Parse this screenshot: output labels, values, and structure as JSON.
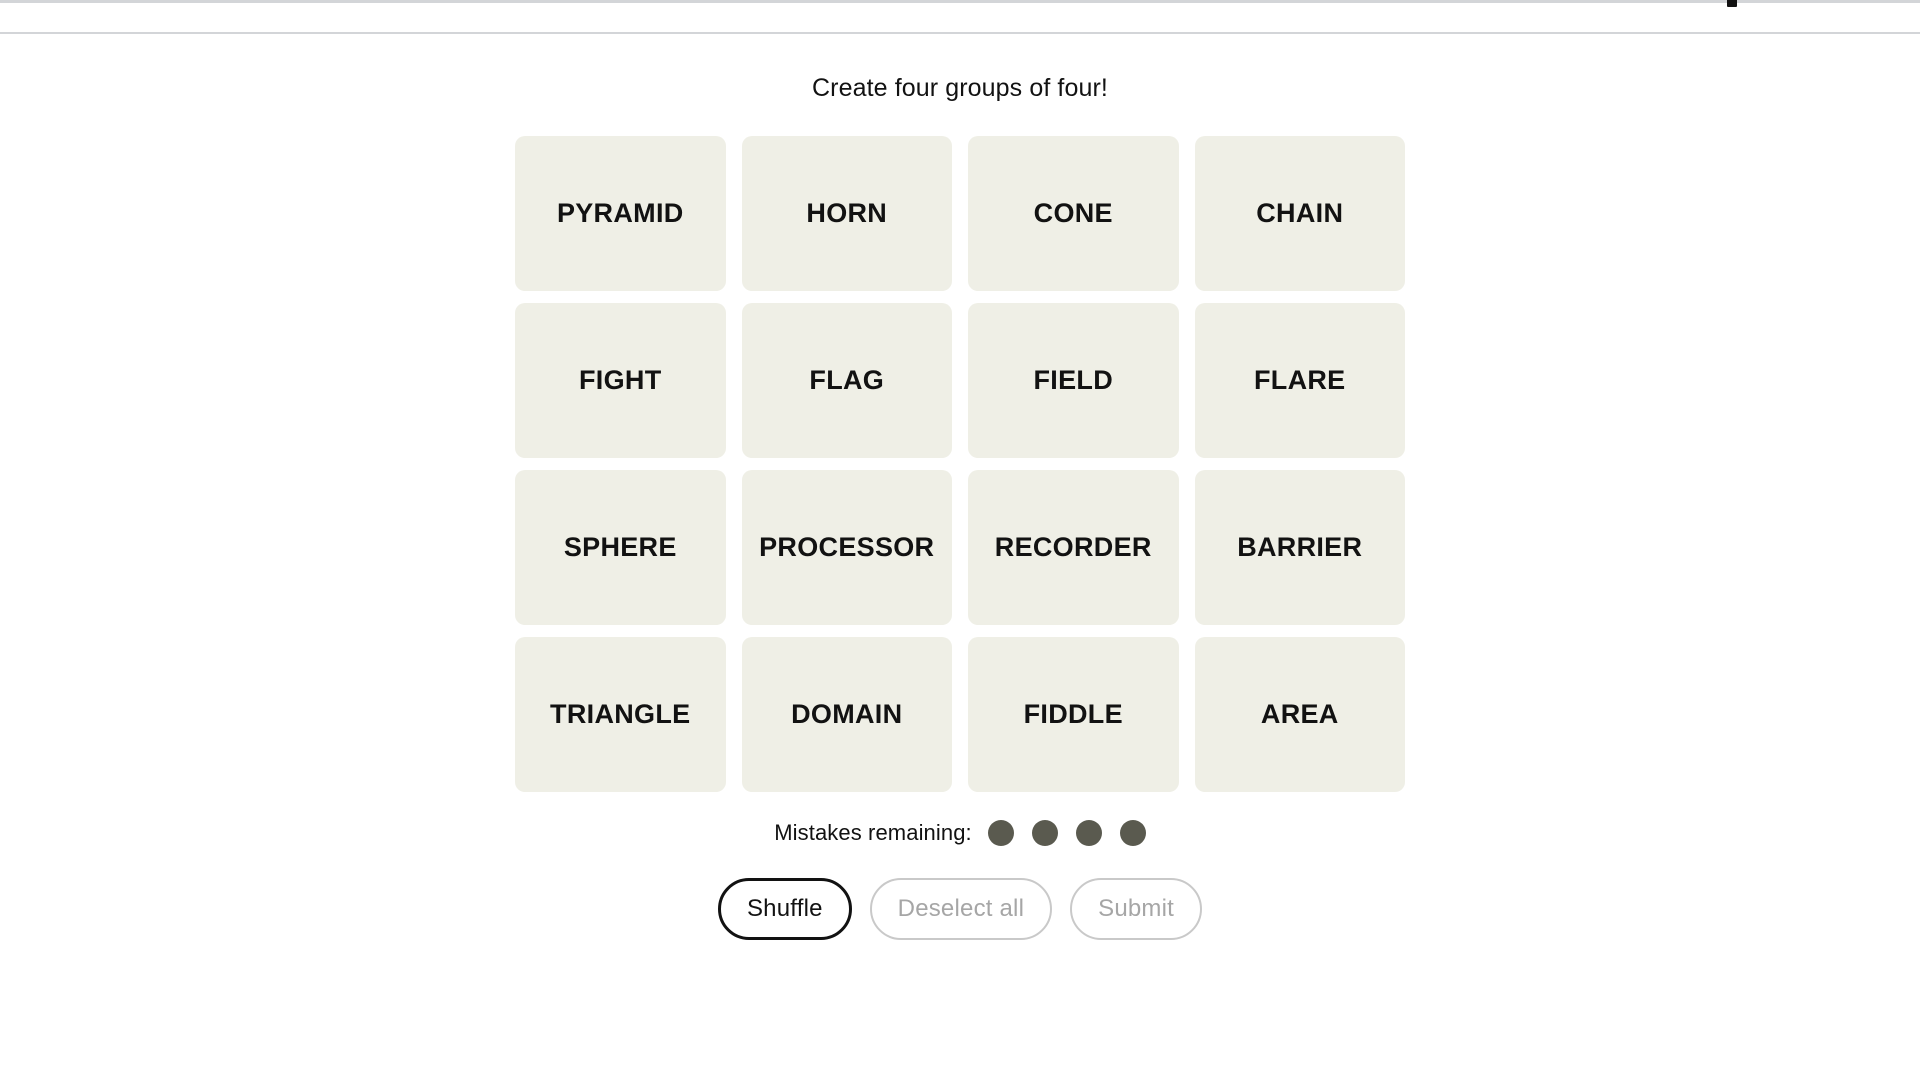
{
  "chrome": {
    "icons": [
      {
        "name": "kebab-menu-icon",
        "glyph": "vertical-dots"
      },
      {
        "name": "help-circle-icon",
        "glyph": "circle"
      }
    ]
  },
  "game": {
    "prompt": "Create four groups of four!",
    "grid": {
      "rows": 4,
      "columns": 4,
      "tiles": [
        {
          "label": "PYRAMID",
          "selected": false
        },
        {
          "label": "HORN",
          "selected": false
        },
        {
          "label": "CONE",
          "selected": false
        },
        {
          "label": "CHAIN",
          "selected": false
        },
        {
          "label": "FIGHT",
          "selected": false
        },
        {
          "label": "FLAG",
          "selected": false
        },
        {
          "label": "FIELD",
          "selected": false
        },
        {
          "label": "FLARE",
          "selected": false
        },
        {
          "label": "SPHERE",
          "selected": false
        },
        {
          "label": "PROCESSOR",
          "selected": false
        },
        {
          "label": "RECORDER",
          "selected": false
        },
        {
          "label": "BARRIER",
          "selected": false
        },
        {
          "label": "TRIANGLE",
          "selected": false
        },
        {
          "label": "DOMAIN",
          "selected": false
        },
        {
          "label": "FIDDLE",
          "selected": false
        },
        {
          "label": "AREA",
          "selected": false
        }
      ]
    },
    "mistakes": {
      "label": "Mistakes remaining:",
      "remaining": 4,
      "dot_color": "#5a5a4f"
    },
    "actions": [
      {
        "label": "Shuffle",
        "state": "enabled"
      },
      {
        "label": "Deselect all",
        "state": "disabled"
      },
      {
        "label": "Submit",
        "state": "disabled"
      }
    ]
  },
  "colors": {
    "page_background": "#ffffff",
    "tile_background": "#efefe6",
    "text": "#121212",
    "muted_text": "#a6a6a6",
    "border": "#d3d5d8"
  }
}
